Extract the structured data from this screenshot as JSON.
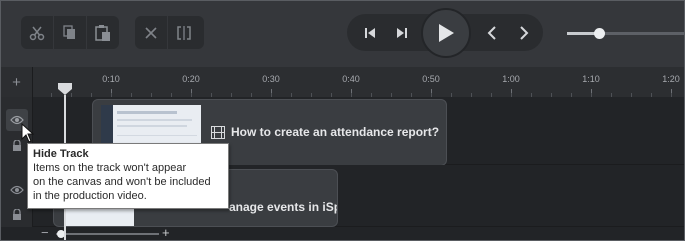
{
  "toolbar": {
    "edit_buttons": [
      "scissors-icon",
      "copy-icon",
      "paste-icon"
    ],
    "edit_buttons2": [
      "delete-icon",
      "split-icon"
    ],
    "playback": [
      "step-back-icon",
      "step-forward-icon",
      "play-icon",
      "prev-marker-icon",
      "next-marker-icon"
    ],
    "zoom_slider_value": 0.27
  },
  "ruler": {
    "ticks": [
      "0:10",
      "0:20",
      "0:30",
      "0:40",
      "0:50",
      "1:00",
      "1:10",
      "1:20"
    ],
    "add_track_label": "+"
  },
  "tracks": [
    {
      "clip_title": "How to create an attendance report?"
    },
    {
      "clip_title": "anage events in iSp"
    }
  ],
  "tooltip": {
    "title": "Hide Track",
    "body_lines": [
      "Items on the track won't appear",
      "on the canvas and won't be included",
      "in the production video."
    ]
  },
  "timeline_zoom": {
    "minus": "−",
    "plus": "+",
    "value": 0.05
  },
  "colors": {
    "accent": "#d9dbde",
    "background": "#222427",
    "toolbar": "#35373b"
  }
}
